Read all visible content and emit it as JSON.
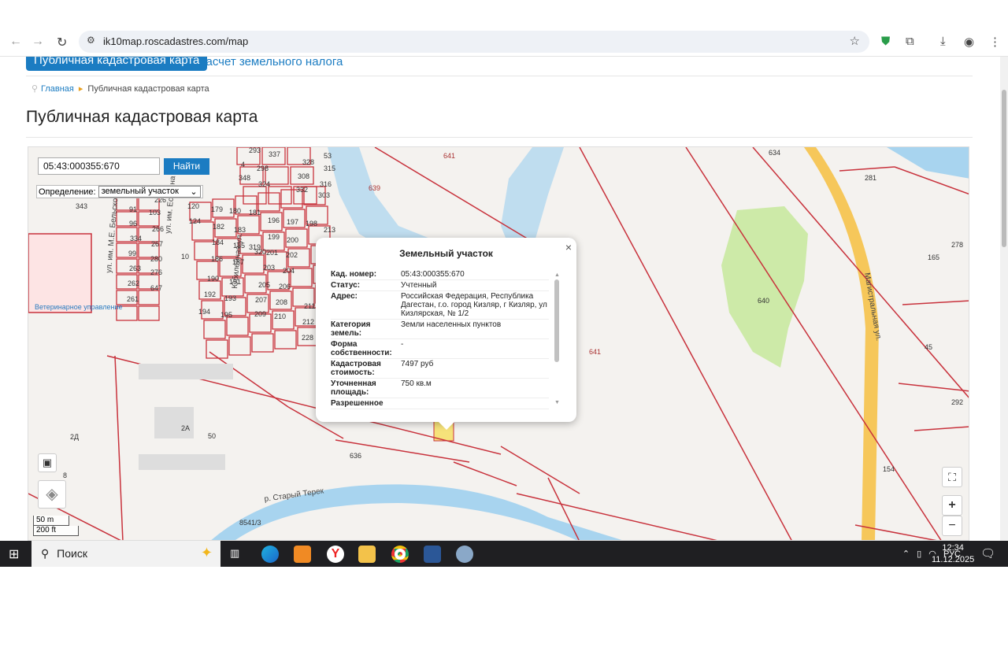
{
  "browser": {
    "url": "ik10map.roscadastres.com/map"
  },
  "site": {
    "tabs": [
      {
        "label": "Публичная кадастровая карта",
        "active": true
      },
      {
        "label": "Расчет земельного налога",
        "active": false
      }
    ],
    "breadcrumb": {
      "home": "Главная",
      "current": "Публичная кадастровая карта"
    },
    "title": "Публичная кадастровая карта"
  },
  "map": {
    "search_value": "05:43:000355:670",
    "search_button": "Найти",
    "definition_label": "Определение:",
    "definition_value": "земельный участок",
    "scale_metric": "50 m",
    "scale_imperial": "200 ft",
    "labels": [
      "641",
      "639",
      "640",
      "641",
      "636",
      "634",
      "278",
      "165",
      "45",
      "292",
      "281",
      "154",
      "8541/3",
      "50",
      "2А",
      "2Д",
      "8",
      "10",
      "319",
      "320",
      "343",
      "4",
      "53",
      "293",
      "337",
      "328",
      "315",
      "348",
      "324",
      "298",
      "308",
      "316",
      "332",
      "303",
      "91",
      "103",
      "96",
      "266",
      "334",
      "267",
      "99",
      "280",
      "263",
      "276",
      "262",
      "647",
      "261",
      "120",
      "124",
      "179",
      "180",
      "181",
      "196",
      "197",
      "198",
      "213",
      "182",
      "183",
      "199",
      "200",
      "184",
      "185",
      "201",
      "202",
      "186",
      "187",
      "203",
      "204",
      "190",
      "191",
      "205",
      "206",
      "192",
      "193",
      "207",
      "208",
      "194",
      "195",
      "209",
      "210",
      "211",
      "212",
      "228",
      "226",
      "642"
    ],
    "street_labels": [
      "ул. им. М.Е. Бельского",
      "ул. им. Есенина",
      "Юбилейная ул.",
      "Магистральная ул.",
      "р. Старый Терек"
    ],
    "poi": [
      "Ветеринарное управление"
    ],
    "colors": {
      "parcel": "#c8323c",
      "water": "#a8d4ef",
      "green": "#cdeaa8",
      "road": "#f6c75a",
      "accent": "#1b7cc2"
    }
  },
  "popup": {
    "title": "Земельный участок",
    "rows": [
      {
        "k": "Кад. номер:",
        "v": "05:43:000355:670"
      },
      {
        "k": "Статус:",
        "v": "Учтенный"
      },
      {
        "k": "Адрес:",
        "v": "Российская Федерация, Республика Дагестан, г.о. город Кизляр, г Кизляр, ул Кизлярская, № 1/2"
      },
      {
        "k": "Категория земель:",
        "v": "Земли населенных пунктов"
      },
      {
        "k": "Форма собственности:",
        "v": "-"
      },
      {
        "k": "Кадастровая стоимость:",
        "v": "7497 руб"
      },
      {
        "k": "Уточненная площадь:",
        "v": "750 кв.м"
      },
      {
        "k": "Разрешенное",
        "v": ""
      }
    ]
  },
  "taskbar": {
    "search": "Поиск",
    "lang": "РУС",
    "time": "12:34",
    "date": "11.12.2025",
    "notifications": "1"
  }
}
